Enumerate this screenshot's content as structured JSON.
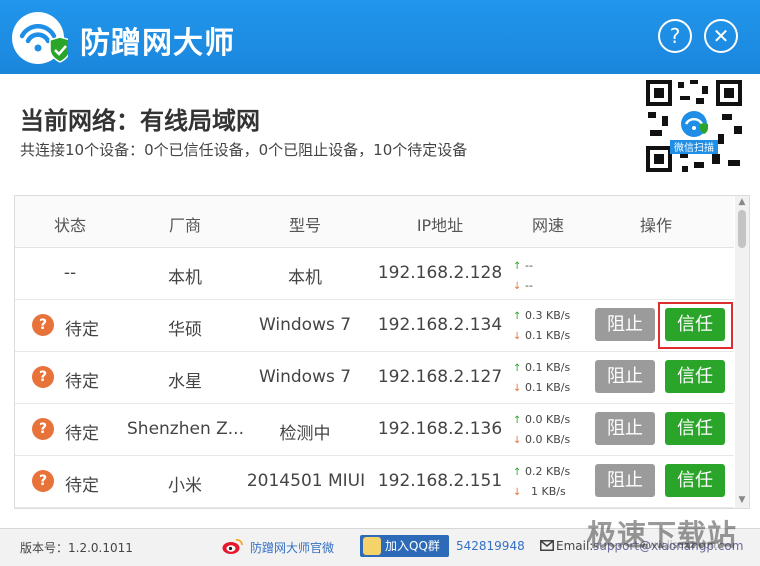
{
  "app": {
    "title": "防蹭网大师"
  },
  "header": {
    "help_label": "?",
    "close_label": "✕"
  },
  "network": {
    "title": "当前网络：有线局域网",
    "summary": "共连接10个设备：0个已信任设备，0个已阻止设备，10个待定设备"
  },
  "qr": {
    "caption": "微信扫描"
  },
  "table": {
    "headers": [
      "状态",
      "厂商",
      "型号",
      "IP地址",
      "网速",
      "操作"
    ],
    "rows": [
      {
        "status": "--",
        "vendor": "本机",
        "model": "本机",
        "ip": "192.168.2.128",
        "up": "--",
        "down": "--"
      },
      {
        "status": "待定",
        "vendor": "华硕",
        "model": "Windows 7",
        "ip": "192.168.2.134",
        "up": "0.3 KB/s",
        "down": "0.1 KB/s",
        "block": "阻止",
        "trust": "信任"
      },
      {
        "status": "待定",
        "vendor": "水星",
        "model": "Windows 7",
        "ip": "192.168.2.127",
        "up": "0.1 KB/s",
        "down": "0.1 KB/s",
        "block": "阻止",
        "trust": "信任"
      },
      {
        "status": "待定",
        "vendor": "Shenzhen Z...",
        "model": "检测中",
        "ip": "192.168.2.136",
        "up": "0.0 KB/s",
        "down": "0.0 KB/s",
        "block": "阻止",
        "trust": "信任"
      },
      {
        "status": "待定",
        "vendor": "小米",
        "model": "2014501 MIUI",
        "ip": "192.168.2.151",
        "up": "0.2 KB/s",
        "down": "1 KB/s",
        "block": "阻止",
        "trust": "信任"
      }
    ]
  },
  "footer": {
    "version": "版本号：1.2.0.1011",
    "weibo": "防蹭网大师官微",
    "qq_join": "加入QQ群",
    "qq_number": "542819948",
    "email_label": "Email:",
    "email_value": "support@xiaonangp.com"
  },
  "watermark": {
    "text": "极速下载站",
    "url": "www.jisuxz.com"
  },
  "colors": {
    "header": "#1f8ee6",
    "trust": "#2aa52a",
    "block": "#9b9b9b",
    "pending": "#e8733a",
    "highlight": "#e02d2d"
  }
}
